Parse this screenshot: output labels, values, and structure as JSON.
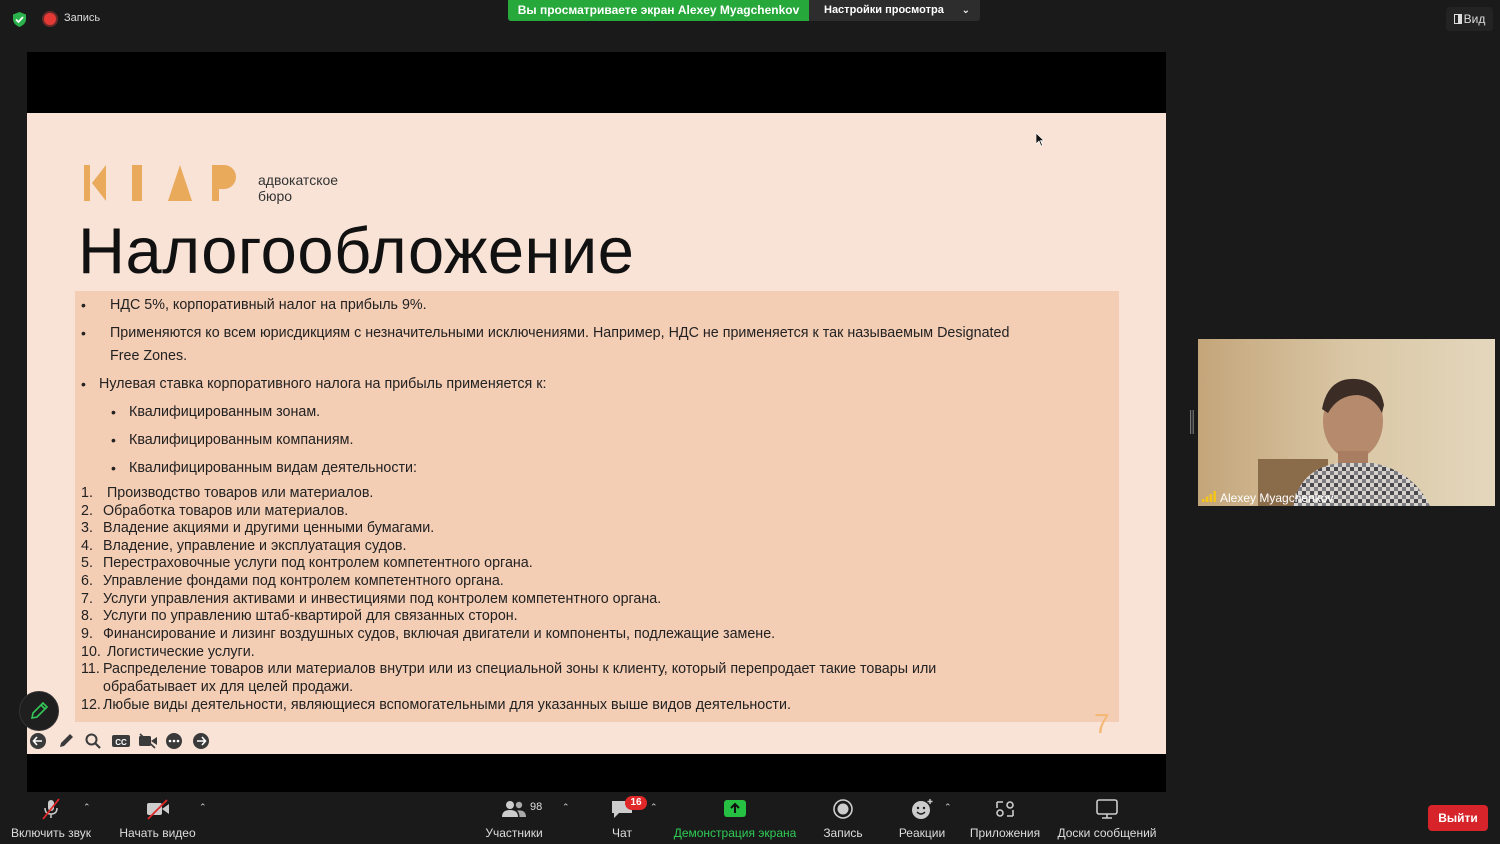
{
  "topbar": {
    "recording_label": "Запись",
    "share_banner": "Вы просматриваете экран Alexey Myagchenkov",
    "view_settings": "Настройки просмотра",
    "view_button": "Вид"
  },
  "slide": {
    "logo_text": "КІАР",
    "logo_sub_line1": "адвокатское",
    "logo_sub_line2": "бюро",
    "title": "Налогообложение",
    "bullets": [
      "НДС 5%, корпоративный налог на прибыль 9%.",
      "Применяются ко всем юрисдикциям с незначительными исключениями. Например, НДС не применяется к так называемым Designated",
      "Free Zones.",
      "Нулевая ставка корпоративного налога на прибыль применяется к:"
    ],
    "sub_bullets": [
      "Квалифицированным зонам.",
      "Квалифицированным компаниям.",
      "Квалифицированным видам деятельности:"
    ],
    "numbered": [
      {
        "n": "1.",
        "text": "Производство товаров или материалов."
      },
      {
        "n": "2.",
        "text": "Обработка товаров или материалов."
      },
      {
        "n": "3.",
        "text": "Владение акциями и другими ценными бумагами."
      },
      {
        "n": "4.",
        "text": "Владение, управление и эксплуатация судов."
      },
      {
        "n": "5.",
        "text": "Перестраховочные услуги под контролем компетентного органа."
      },
      {
        "n": "6.",
        "text": "Управление фондами под контролем компетентного органа."
      },
      {
        "n": "7.",
        "text": "Услуги управления активами и инвестициями под контролем компетентного органа."
      },
      {
        "n": "8.",
        "text": "Услуги по управлению штаб-квартирой для связанных сторон."
      },
      {
        "n": "9.",
        "text": "Финансирование и лизинг воздушных судов, включая двигатели и компоненты, подлежащие замене."
      },
      {
        "n": "10.",
        "text": "Логистические услуги."
      },
      {
        "n": "11.",
        "text": "Распределение товаров или материалов внутри или из специальной зоны к клиенту, который перепродает такие товары или"
      },
      {
        "n": "",
        "text": "обрабатывает их для целей продажи."
      },
      {
        "n": "12.",
        "text": "Любые виды деятельности, являющиеся вспомогательными для указанных выше видов деятельности."
      }
    ],
    "page_number": "7"
  },
  "video": {
    "participant_name": "Alexey Myagchenkov"
  },
  "toolbar": {
    "unmute": "Включить звук",
    "start_video": "Начать видео",
    "participants": "Участники",
    "participants_count": "98",
    "chat": "Чат",
    "chat_badge": "16",
    "share_screen": "Демонстрация экрана",
    "record": "Запись",
    "reactions": "Реакции",
    "apps": "Приложения",
    "whiteboards": "Доски сообщений",
    "leave": "Выйти"
  },
  "colors": {
    "share_green": "#26a83b",
    "leave_red": "#d7242b",
    "slide_bg": "#f8e3d6",
    "content_bg": "#f4cdb5",
    "logo_gold": "#e9aa5c"
  }
}
